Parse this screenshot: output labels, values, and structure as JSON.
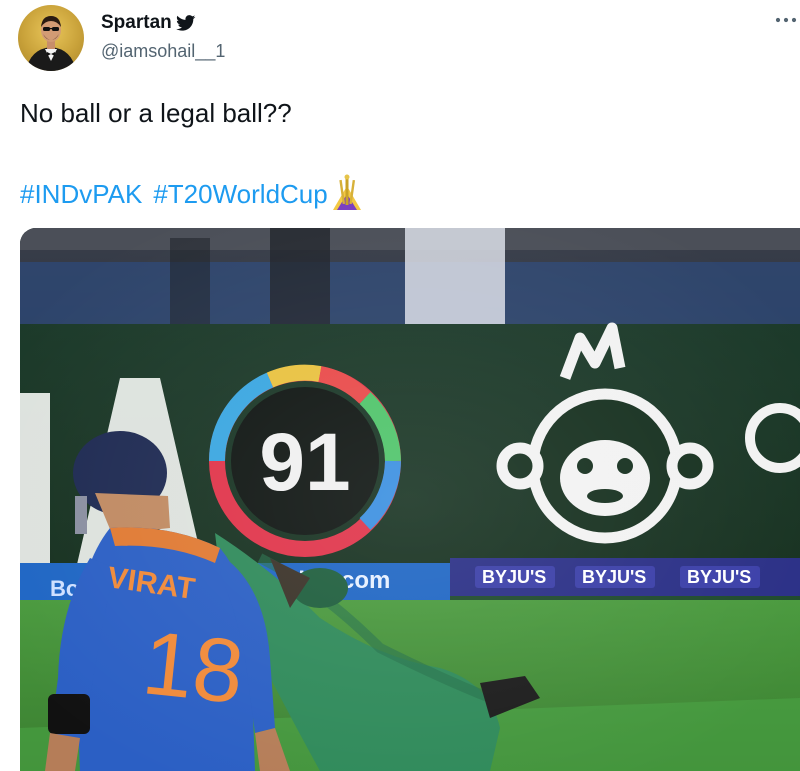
{
  "author": {
    "display_name": "Spartan",
    "handle": "@iamsohail__1",
    "avatar_icon": "profile-photo-avatar",
    "platform_icon": "twitter-bird-icon"
  },
  "tweet": {
    "text": "No ball or a legal ball??",
    "hashtags": [
      "#INDvPAK",
      "#T20WorldCup"
    ],
    "hashtag_emoji_icon": "t20-world-cup-trophy-emoji"
  },
  "menu": {
    "icon": "more-options-icon"
  },
  "media": {
    "board_number": "91",
    "board_text": "king.com",
    "board_text_left": "Bo",
    "sponsor_text": "BYJU'S",
    "player_name": "VIRAT",
    "player_number": "18"
  },
  "colors": {
    "link": "#1d9bf0",
    "text_primary": "#0f1419",
    "text_secondary": "#536471",
    "india_jersey": "#2b5fc4",
    "pakistan_jersey": "#2f8a5a",
    "pitch": "#3f8f3a"
  }
}
